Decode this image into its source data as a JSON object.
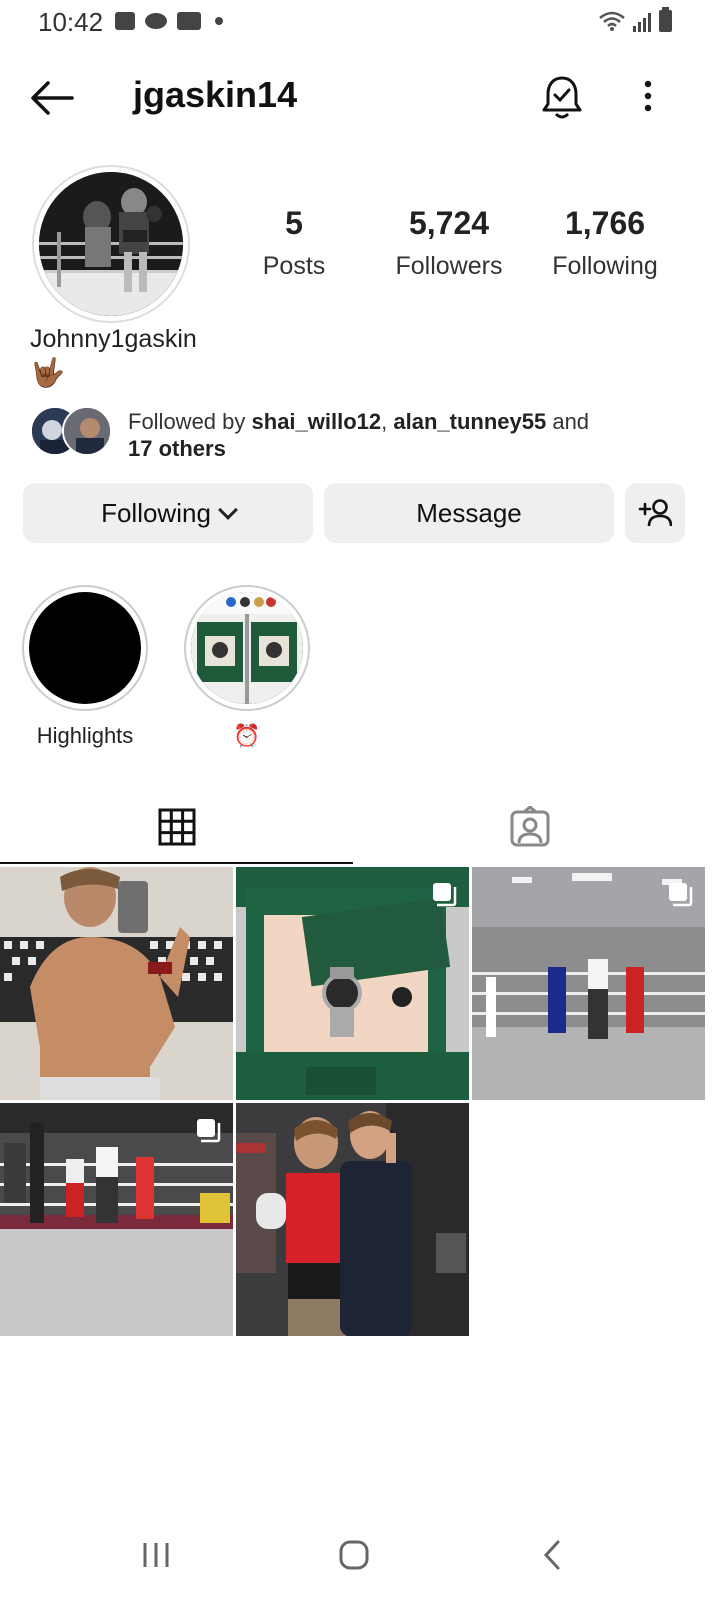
{
  "status_bar": {
    "time": "10:42"
  },
  "header": {
    "username": "jgaskin14"
  },
  "profile": {
    "display_name": "Johnny1gaskin",
    "bio_emoji": "🤟🏾",
    "stats": {
      "posts_count": "5",
      "posts_label": "Posts",
      "followers_count": "5,724",
      "followers_label": "Followers",
      "following_count": "1,766",
      "following_label": "Following"
    },
    "followed_by": {
      "prefix": "Followed by ",
      "user1": "shai_willo12",
      "separator": ", ",
      "user2": "alan_tunney55",
      "and": " and",
      "others": "17 others"
    }
  },
  "actions": {
    "following_label": "Following",
    "message_label": "Message"
  },
  "highlights": [
    {
      "label": "Highlights"
    },
    {
      "label": "⏰"
    }
  ],
  "tabs": {
    "active": "grid",
    "items": [
      "grid-icon",
      "tagged-icon"
    ]
  },
  "posts": [
    {
      "id": "post-1",
      "multi": false
    },
    {
      "id": "post-2",
      "multi": true
    },
    {
      "id": "post-3",
      "multi": true
    },
    {
      "id": "post-4",
      "multi": true
    },
    {
      "id": "post-5",
      "multi": false
    }
  ]
}
